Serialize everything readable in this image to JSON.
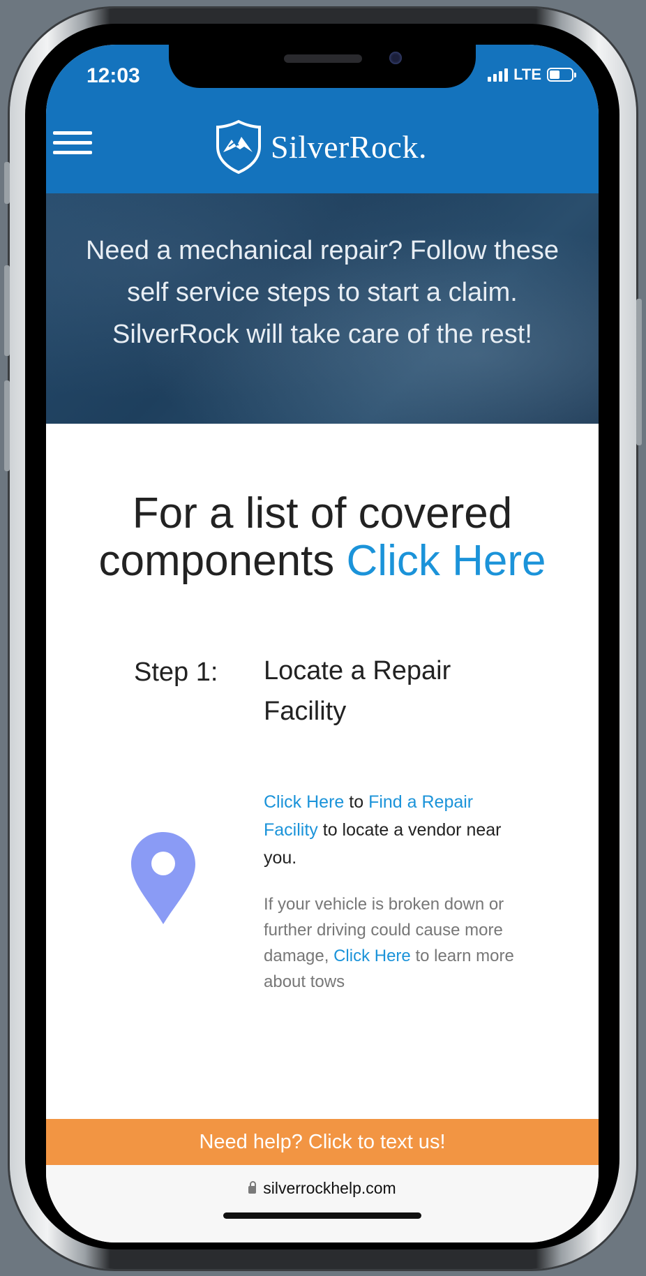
{
  "status_bar": {
    "time": "12:03",
    "network": "LTE"
  },
  "header": {
    "brand": "SilverRock.",
    "menu_icon": "hamburger-menu-icon",
    "logo_icon": "mountain-shield-icon"
  },
  "hero": {
    "text": "Need a mechanical repair? Follow these self service steps to start a claim. SilverRock will take care of the rest!"
  },
  "components": {
    "prefix": "For a list of covered components",
    "link": "Click Here"
  },
  "step1": {
    "label": "Step 1:",
    "title": "Locate a Repair Facility",
    "icon": "location-pin-icon",
    "desc_link1": "Click Here",
    "desc_mid": "to",
    "desc_link2": "Find a Repair Facility",
    "desc_end": "to locate a vendor near you.",
    "note_start": "If your vehicle is broken down or further driving could cause more damage,",
    "note_link": "Click Here",
    "note_end": "to learn more about tows"
  },
  "help_bar": {
    "label": "Need help? Click to text us!"
  },
  "browser": {
    "url": "silverrockhelp.com"
  },
  "colors": {
    "header_blue": "#1473bd",
    "link_blue": "#1b93d9",
    "help_orange": "#f29543",
    "pin_color": "#8a9bf5"
  }
}
